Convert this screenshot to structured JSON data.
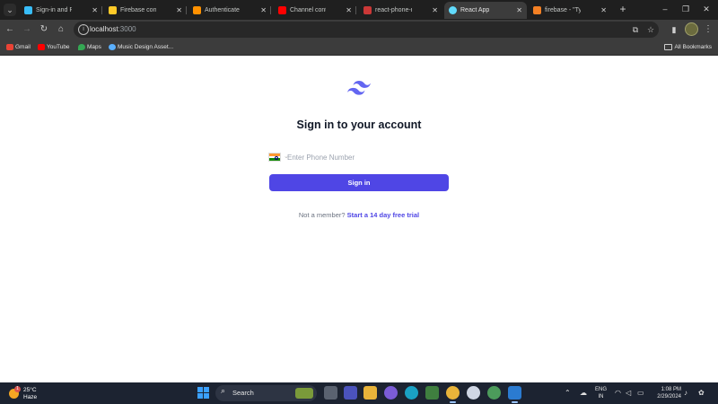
{
  "browser": {
    "tabs": [
      {
        "title": "Sign-in and Registrat",
        "favicon_color": "#38bdf8",
        "active": false
      },
      {
        "title": "Firebase console",
        "favicon_color": "#ffca28",
        "active": false
      },
      {
        "title": "Authenticate with Fi",
        "favicon_color": "#ff9100",
        "active": false
      },
      {
        "title": "Channel content - Yo",
        "favicon_color": "#ff0000",
        "active": false
      },
      {
        "title": "react-phone-number",
        "favicon_color": "#cb3837",
        "active": false
      },
      {
        "title": "React App",
        "favicon_color": "#61dafb",
        "active": true
      },
      {
        "title": "firebase - \"TypeError",
        "favicon_color": "#f48024",
        "active": false
      }
    ],
    "url_host": "localhost",
    "url_port": ":3000",
    "bookmarks": [
      {
        "label": "Gmail",
        "icon_color": "#ea4335"
      },
      {
        "label": "YouTube",
        "icon_color": "#ff0000"
      },
      {
        "label": "Maps",
        "icon_color": "#34a853"
      },
      {
        "label": "Music Design Asset...",
        "icon_color": "#5ab0ff"
      }
    ],
    "all_bookmarks_label": "All Bookmarks"
  },
  "page": {
    "heading": "Sign in to your account",
    "phone_placeholder": "Enter Phone Number",
    "signin_label": "Sign in",
    "not_member_text": "Not a member?",
    "trial_link_text": "Start a 14 day free trial",
    "brand_color": "#4f46e5"
  },
  "taskbar": {
    "temperature": "25°C",
    "condition": "Haze",
    "weather_badge": "1",
    "search_label": "Search",
    "lang_line1": "ENG",
    "lang_line2": "IN",
    "time": "1:08 PM",
    "date": "2/29/2024"
  }
}
